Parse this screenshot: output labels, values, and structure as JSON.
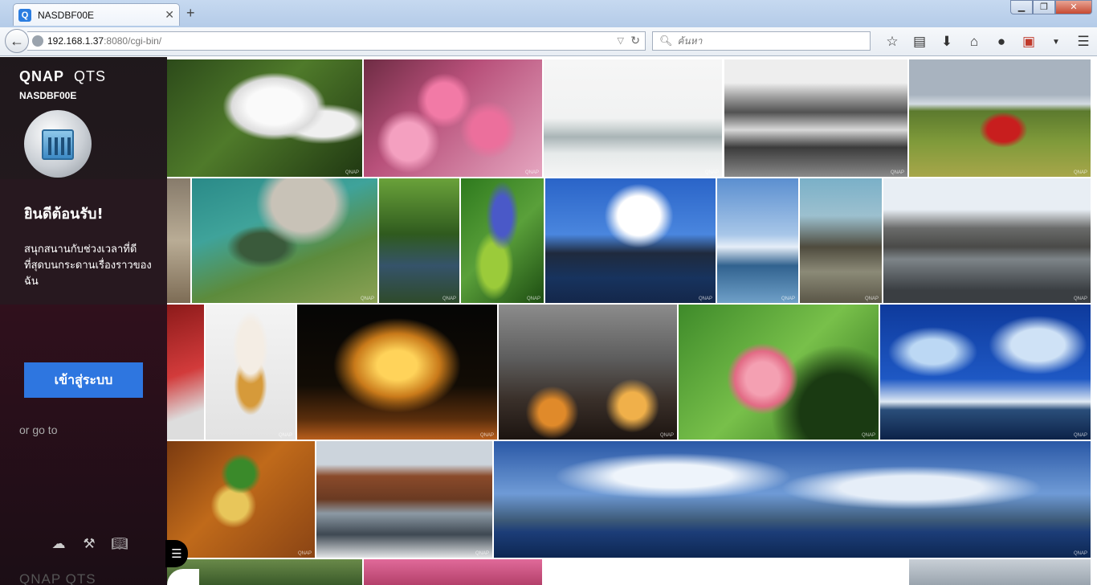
{
  "browser": {
    "tab_title": "NASDBF00E",
    "tab_favicon": "Q",
    "new_tab": "+",
    "window_buttons": {
      "min": "▁",
      "max": "❐",
      "close": "✕"
    },
    "url_host": "192.168.1.37",
    "url_rest": ":8080/cgi-bin/",
    "search_placeholder": "ค้นหา",
    "toolbar_icons": [
      "star-icon",
      "bookmarks-list-icon",
      "download-icon",
      "home-icon",
      "chat-icon",
      "pdf-icon",
      "menu-icon"
    ]
  },
  "panel": {
    "brand_name": "QNAP",
    "brand_product": "QTS",
    "host_name": "NASDBF00E",
    "welcome_title": "ยินดีต้อนรับ!",
    "welcome_text": "สนุกสนานกับช่วงเวลาที่ดีที่สุดบนกระดานเรื่องราวของฉัน",
    "login_button": "เข้าสู่ระบบ",
    "or_go_to": "or go to",
    "footer_brand": "QNAP  QTS"
  },
  "gallery": {
    "watermark": "QNAP",
    "photos": [
      "cyclamen-flowers",
      "pink-cherry-blossoms",
      "boats-at-pier",
      "rocky-shore-waves",
      "red-tractor-field",
      "heart-shaped-weir",
      "forest-stream",
      "blue-agapanthus",
      "overwater-villa",
      "moored-yacht",
      "rock-reef-channel",
      "canal-warehouses",
      "ice-cream-cone",
      "carousel-at-night",
      "rainy-window-city",
      "pink-flower-bud",
      "blue-sky-coast",
      "curry-dish",
      "brick-warehouse-canal",
      "panorama-sea-clouds"
    ]
  },
  "colors": {
    "accent": "#2e76e0",
    "panel_bg": "#1e1218"
  }
}
